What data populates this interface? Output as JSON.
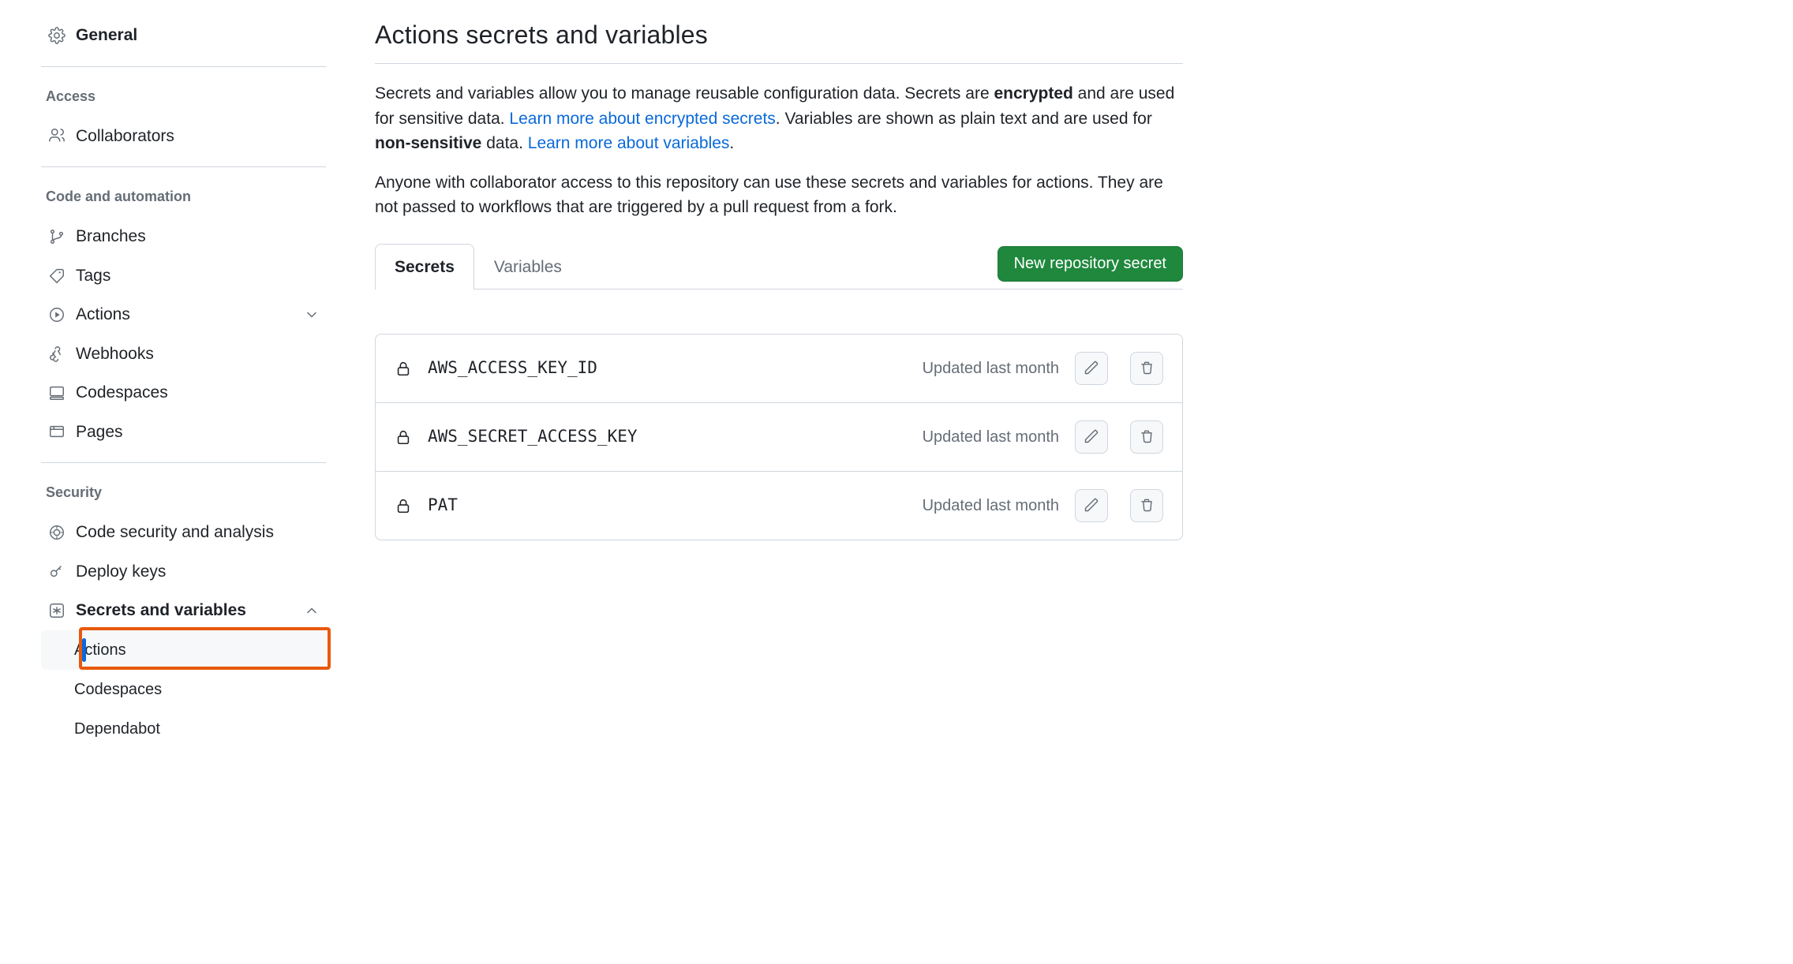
{
  "sidebar": {
    "general_label": "General",
    "access_heading": "Access",
    "collaborators_label": "Collaborators",
    "code_heading": "Code and automation",
    "branches_label": "Branches",
    "tags_label": "Tags",
    "actions_label": "Actions",
    "webhooks_label": "Webhooks",
    "codespaces_label": "Codespaces",
    "pages_label": "Pages",
    "security_heading": "Security",
    "code_security_label": "Code security and analysis",
    "deploy_keys_label": "Deploy keys",
    "secrets_label": "Secrets and variables",
    "sub_actions_label": "Actions",
    "sub_codespaces_label": "Codespaces",
    "sub_dependabot_label": "Dependabot"
  },
  "main": {
    "title": "Actions secrets and variables",
    "desc": {
      "p1a": "Secrets and variables allow you to manage reusable configuration data. Secrets are ",
      "p1_strong1": "encrypted",
      "p1b": " and are used for sensitive data. ",
      "link1": "Learn more about encrypted secrets",
      "p1c": ". Variables are shown as plain text and are used for ",
      "p1_strong2": "non-sensitive",
      "p1d": " data. ",
      "link2": "Learn more about variables",
      "p1e": ".",
      "p2": "Anyone with collaborator access to this repository can use these secrets and variables for actions. They are not passed to workflows that are triggered by a pull request from a fork."
    },
    "tabs": {
      "secrets": "Secrets",
      "variables": "Variables"
    },
    "new_button": "New repository secret",
    "secrets": [
      {
        "name": "AWS_ACCESS_KEY_ID",
        "updated": "Updated last month"
      },
      {
        "name": "AWS_SECRET_ACCESS_KEY",
        "updated": "Updated last month"
      },
      {
        "name": "PAT",
        "updated": "Updated last month"
      }
    ]
  }
}
